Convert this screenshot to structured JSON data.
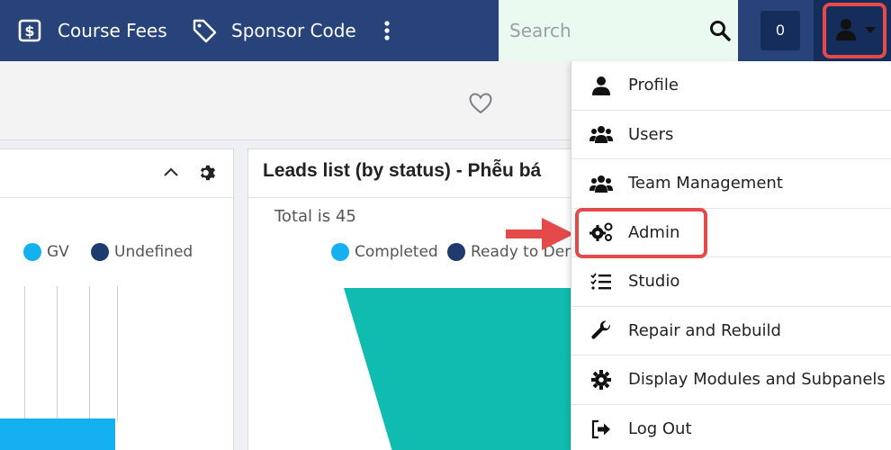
{
  "nav": {
    "course_fees": "Course Fees",
    "sponsor_code": "Sponsor Code",
    "more_icon": "vertical-dots-icon"
  },
  "search": {
    "placeholder": "Search"
  },
  "counter": {
    "value": "0"
  },
  "left_panel": {
    "legend": [
      {
        "label": "GV",
        "color": "#14b0f0"
      },
      {
        "label": "Undefined",
        "color": "#1e3a6e"
      }
    ]
  },
  "mid_panel": {
    "title": "Leads list (by status) - Phễu bá",
    "total": "Total is 45",
    "legend": [
      {
        "label": "Completed",
        "color": "#14b0f0"
      },
      {
        "label": "Ready to Dem",
        "color": "#1e3a6e"
      }
    ],
    "funnel_color": "#10bcb0"
  },
  "user_menu": {
    "items": [
      {
        "label": "Profile",
        "icon": "user-icon"
      },
      {
        "label": "Users",
        "icon": "users-icon"
      },
      {
        "label": "Team Management",
        "icon": "users-icon"
      },
      {
        "label": "Admin",
        "icon": "cogs-icon"
      },
      {
        "label": "Studio",
        "icon": "list-check-icon"
      },
      {
        "label": "Repair and Rebuild",
        "icon": "wrench-icon"
      },
      {
        "label": "Display Modules and Subpanels",
        "icon": "gear-icon"
      },
      {
        "label": "Log Out",
        "icon": "sign-out-icon"
      }
    ]
  },
  "colors": {
    "topbar": "#27437a",
    "highlight": "#e54a4a"
  }
}
